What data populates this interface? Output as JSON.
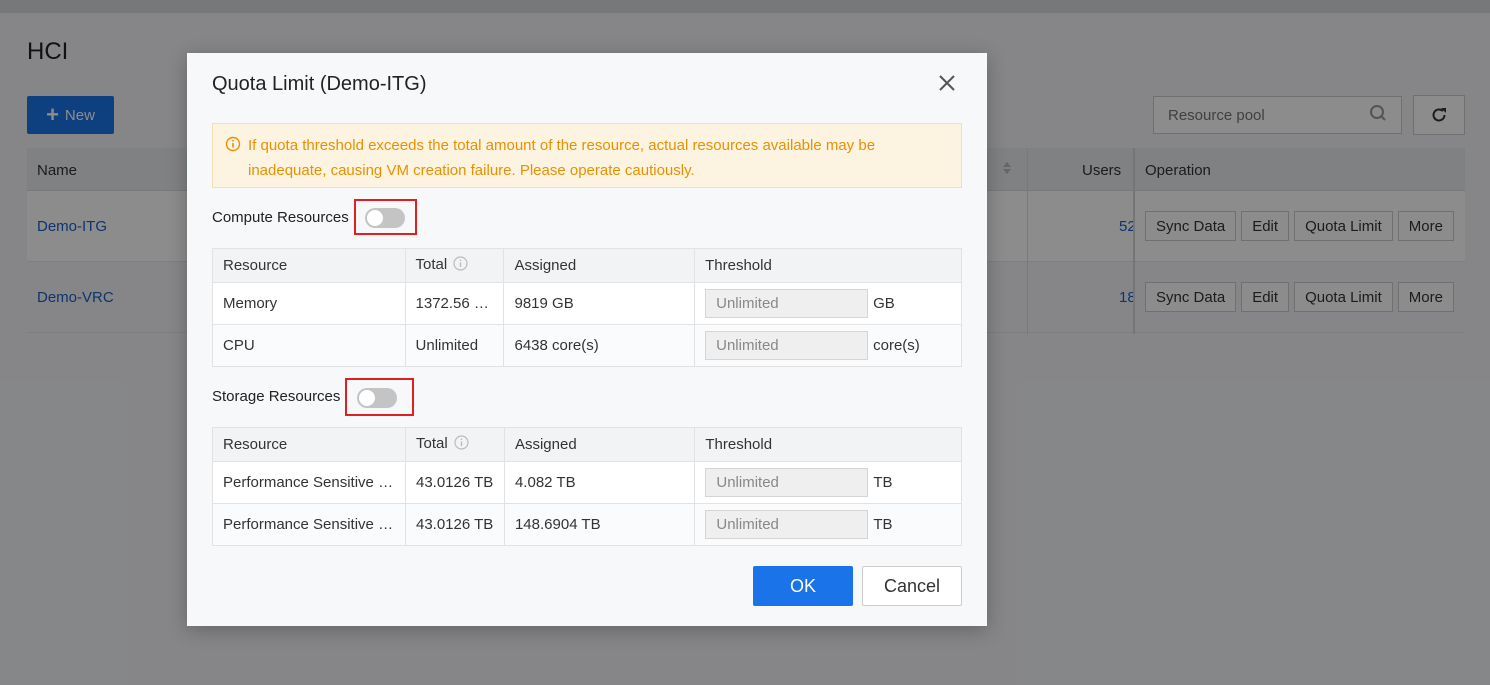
{
  "page": {
    "title": "HCI",
    "new_label": "New",
    "search_placeholder": "Resource pool",
    "columns": {
      "name": "Name",
      "users": "Users",
      "operation": "Operation"
    },
    "rows": [
      {
        "name": "Demo-ITG",
        "users": "52"
      },
      {
        "name": "Demo-VRC",
        "users": "18"
      }
    ],
    "ops": [
      "Sync Data",
      "Edit",
      "Quota Limit",
      "More"
    ]
  },
  "modal": {
    "title": "Quota Limit (Demo-ITG)",
    "warning": "If quota threshold exceeds the total amount of the resource, actual resources available may be inadequate, causing VM creation failure. Please operate cautiously.",
    "compute": {
      "label": "Compute Resources",
      "enabled": false,
      "headers": [
        "Resource",
        "Total",
        "Assigned",
        "Threshold"
      ],
      "rows": [
        {
          "resource": "Memory",
          "total": "1372.56 …",
          "assigned": "9819 GB",
          "threshold": "Unlimited",
          "unit": "GB"
        },
        {
          "resource": "CPU",
          "total": "Unlimited",
          "assigned": "6438 core(s)",
          "threshold": "Unlimited",
          "unit": "core(s)"
        }
      ]
    },
    "storage": {
      "label": "Storage Resources",
      "enabled": false,
      "headers": [
        "Resource",
        "Total",
        "Assigned",
        "Threshold"
      ],
      "rows": [
        {
          "resource": "Performance Sensitive …",
          "total": "43.0126 TB",
          "assigned": "4.082 TB",
          "threshold": "Unlimited",
          "unit": "TB"
        },
        {
          "resource": "Performance Sensitive …",
          "total": "43.0126 TB",
          "assigned": "148.6904 TB",
          "threshold": "Unlimited",
          "unit": "TB"
        }
      ]
    },
    "ok_label": "OK",
    "cancel_label": "Cancel"
  },
  "colors": {
    "primary": "#1a73e8",
    "warning_text": "#e79100",
    "highlight_frame": "#e0201f",
    "link": "#1a5fc7"
  }
}
